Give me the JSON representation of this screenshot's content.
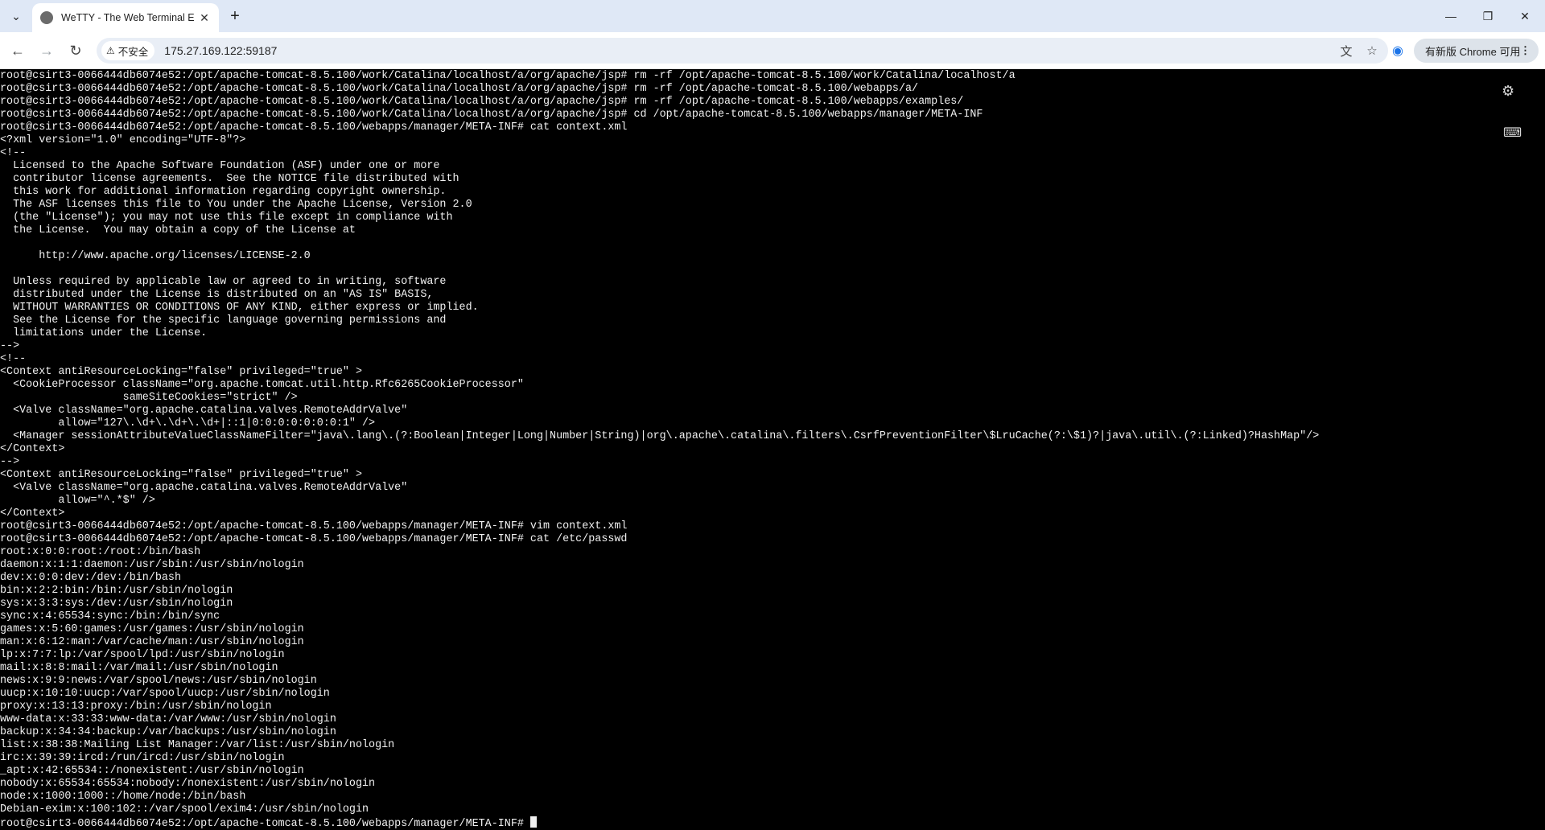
{
  "browser": {
    "tab_title": "WeTTY - The Web Terminal E",
    "url": "175.27.169.122:59187",
    "security_label": "不安全",
    "update_label": "有新版 Chrome 可用",
    "icons": {
      "tab_menu": "chevron-down-icon",
      "favicon": "globe-icon",
      "close_tab": "close-icon",
      "new_tab": "plus-icon",
      "back": "back-arrow-icon",
      "forward": "forward-arrow-icon",
      "reload": "reload-icon",
      "warning": "warning-icon",
      "translate": "translate-icon",
      "bookmark": "star-icon",
      "profile": "profile-icon",
      "menu": "more-vert-icon",
      "minimize": "minimize-icon",
      "restore": "restore-icon",
      "close_window": "close-window-icon"
    }
  },
  "terminal": {
    "icons": {
      "settings": "gears-icon",
      "keyboard": "keyboard-icon"
    },
    "lines": [
      "root@csirt3-0066444db6074e52:/opt/apache-tomcat-8.5.100/work/Catalina/localhost/a/org/apache/jsp# rm -rf /opt/apache-tomcat-8.5.100/work/Catalina/localhost/a",
      "root@csirt3-0066444db6074e52:/opt/apache-tomcat-8.5.100/work/Catalina/localhost/a/org/apache/jsp# rm -rf /opt/apache-tomcat-8.5.100/webapps/a/",
      "root@csirt3-0066444db6074e52:/opt/apache-tomcat-8.5.100/work/Catalina/localhost/a/org/apache/jsp# rm -rf /opt/apache-tomcat-8.5.100/webapps/examples/",
      "root@csirt3-0066444db6074e52:/opt/apache-tomcat-8.5.100/work/Catalina/localhost/a/org/apache/jsp# cd /opt/apache-tomcat-8.5.100/webapps/manager/META-INF",
      "root@csirt3-0066444db6074e52:/opt/apache-tomcat-8.5.100/webapps/manager/META-INF# cat context.xml",
      "<?xml version=\"1.0\" encoding=\"UTF-8\"?>",
      "<!--",
      "  Licensed to the Apache Software Foundation (ASF) under one or more",
      "  contributor license agreements.  See the NOTICE file distributed with",
      "  this work for additional information regarding copyright ownership.",
      "  The ASF licenses this file to You under the Apache License, Version 2.0",
      "  (the \"License\"); you may not use this file except in compliance with",
      "  the License.  You may obtain a copy of the License at",
      "",
      "      http://www.apache.org/licenses/LICENSE-2.0",
      "",
      "  Unless required by applicable law or agreed to in writing, software",
      "  distributed under the License is distributed on an \"AS IS\" BASIS,",
      "  WITHOUT WARRANTIES OR CONDITIONS OF ANY KIND, either express or implied.",
      "  See the License for the specific language governing permissions and",
      "  limitations under the License.",
      "-->",
      "<!--",
      "<Context antiResourceLocking=\"false\" privileged=\"true\" >",
      "  <CookieProcessor className=\"org.apache.tomcat.util.http.Rfc6265CookieProcessor\"",
      "                   sameSiteCookies=\"strict\" />",
      "  <Valve className=\"org.apache.catalina.valves.RemoteAddrValve\"",
      "         allow=\"127\\.\\d+\\.\\d+\\.\\d+|::1|0:0:0:0:0:0:0:1\" />",
      "  <Manager sessionAttributeValueClassNameFilter=\"java\\.lang\\.(?:Boolean|Integer|Long|Number|String)|org\\.apache\\.catalina\\.filters\\.CsrfPreventionFilter\\$LruCache(?:\\$1)?|java\\.util\\.(?:Linked)?HashMap\"/>",
      "</Context>",
      "-->",
      "<Context antiResourceLocking=\"false\" privileged=\"true\" >",
      "  <Valve className=\"org.apache.catalina.valves.RemoteAddrValve\"",
      "         allow=\"^.*$\" />",
      "</Context>",
      "root@csirt3-0066444db6074e52:/opt/apache-tomcat-8.5.100/webapps/manager/META-INF# vim context.xml",
      "root@csirt3-0066444db6074e52:/opt/apache-tomcat-8.5.100/webapps/manager/META-INF# cat /etc/passwd",
      "root:x:0:0:root:/root:/bin/bash",
      "daemon:x:1:1:daemon:/usr/sbin:/usr/sbin/nologin",
      "dev:x:0:0:dev:/dev:/bin/bash",
      "bin:x:2:2:bin:/bin:/usr/sbin/nologin",
      "sys:x:3:3:sys:/dev:/usr/sbin/nologin",
      "sync:x:4:65534:sync:/bin:/bin/sync",
      "games:x:5:60:games:/usr/games:/usr/sbin/nologin",
      "man:x:6:12:man:/var/cache/man:/usr/sbin/nologin",
      "lp:x:7:7:lp:/var/spool/lpd:/usr/sbin/nologin",
      "mail:x:8:8:mail:/var/mail:/usr/sbin/nologin",
      "news:x:9:9:news:/var/spool/news:/usr/sbin/nologin",
      "uucp:x:10:10:uucp:/var/spool/uucp:/usr/sbin/nologin",
      "proxy:x:13:13:proxy:/bin:/usr/sbin/nologin",
      "www-data:x:33:33:www-data:/var/www:/usr/sbin/nologin",
      "backup:x:34:34:backup:/var/backups:/usr/sbin/nologin",
      "list:x:38:38:Mailing List Manager:/var/list:/usr/sbin/nologin",
      "irc:x:39:39:ircd:/run/ircd:/usr/sbin/nologin",
      "_apt:x:42:65534::/nonexistent:/usr/sbin/nologin",
      "nobody:x:65534:65534:nobody:/nonexistent:/usr/sbin/nologin",
      "node:x:1000:1000::/home/node:/bin/bash",
      "Debian-exim:x:100:102::/var/spool/exim4:/usr/sbin/nologin"
    ],
    "prompt": "root@csirt3-0066444db6074e52:/opt/apache-tomcat-8.5.100/webapps/manager/META-INF# "
  }
}
